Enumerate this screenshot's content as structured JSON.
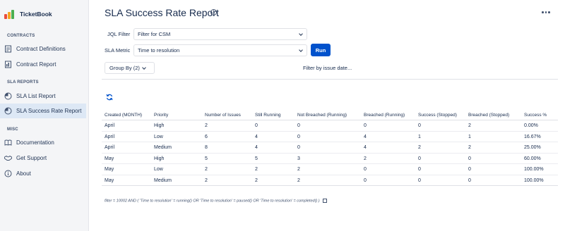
{
  "app": {
    "name": "TicketBook"
  },
  "sidebar": {
    "sections": [
      {
        "label": "CONTRACTS"
      },
      {
        "label": "SLA REPORTS"
      },
      {
        "label": "MISC"
      }
    ],
    "items": [
      {
        "label": "Contract Definitions",
        "icon": "contract-definitions-icon"
      },
      {
        "label": "Contract Report",
        "icon": "contract-report-icon"
      },
      {
        "label": "SLA List Report",
        "icon": "sla-list-icon"
      },
      {
        "label": "SLA Success Rate Report",
        "icon": "sla-success-icon",
        "active": true
      },
      {
        "label": "Documentation",
        "icon": "book-icon"
      },
      {
        "label": "Get Support",
        "icon": "handshake-icon"
      },
      {
        "label": "About",
        "icon": "info-icon"
      }
    ]
  },
  "page": {
    "title": "SLA Success Rate Report"
  },
  "filters": {
    "jql_label": "JQL Filter",
    "jql_value": "Filter for CSM",
    "metric_label": "SLA Metric",
    "metric_value": "Time to resolution",
    "run_label": "Run",
    "group_by_label": "Group By (2)",
    "filter_date_label": "Filter by issue date..."
  },
  "table": {
    "headers": [
      "Created (MONTH)",
      "Priority",
      "Number of Issues",
      "Still Running",
      "Not Breached (Running)",
      "Breached (Running)",
      "Success (Stopped)",
      "Breached (Stopped)",
      "Success %"
    ],
    "rows": [
      [
        "April",
        "High",
        "2",
        "0",
        "0",
        "0",
        "0",
        "2",
        "0.00%"
      ],
      [
        "April",
        "Low",
        "6",
        "4",
        "0",
        "4",
        "1",
        "1",
        "16.67%"
      ],
      [
        "April",
        "Medium",
        "8",
        "4",
        "0",
        "4",
        "2",
        "2",
        "25.00%"
      ],
      [
        "May",
        "High",
        "5",
        "5",
        "3",
        "2",
        "0",
        "0",
        "60.00%"
      ],
      [
        "May",
        "Low",
        "2",
        "2",
        "2",
        "0",
        "0",
        "0",
        "100.00%"
      ],
      [
        "May",
        "Medium",
        "2",
        "2",
        "2",
        "0",
        "0",
        "0",
        "100.00%"
      ]
    ]
  },
  "jql_query": "filter = 10002 AND ( 'Time to resolution' = running() OR 'Time to resolution' = paused() OR 'Time to resolution' = completed() )",
  "colors": {
    "primary": "#0052cc",
    "sidebar_bg": "#f4f5f7",
    "active_bg": "#dde8f5"
  }
}
